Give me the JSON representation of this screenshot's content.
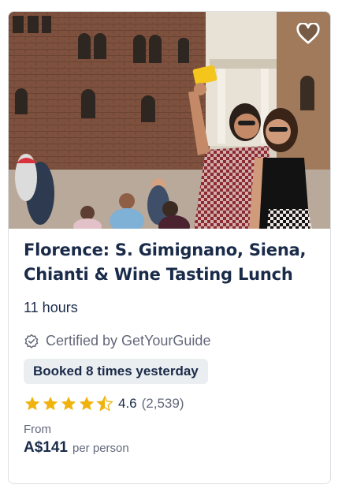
{
  "card": {
    "image_alt_icon": "photo-selfie-siena",
    "wishlist_icon": "heart-outline-icon",
    "title": "Florence: S. Gimignano, Siena, Chianti & Wine Tasting Lunch",
    "title_line1": "Florence: S. Gimignano, Siena,",
    "title_line2": "Chianti & Wine Tasting Lunch",
    "duration": "11 hours",
    "certified_label": "Certified by GetYourGuide",
    "certified_icon": "badge-check-icon",
    "booked_badge": "Booked 8 times yesterday",
    "rating_value": "4.6",
    "rating_stars": 4.6,
    "rating_count": "(2,539)",
    "price_from_label": "From",
    "price": "A$141",
    "price_unit": "per person"
  },
  "colors": {
    "text_primary": "#1a2b49",
    "text_secondary": "#63687a",
    "star": "#f0b30e",
    "badge_bg": "#ebeef1"
  }
}
